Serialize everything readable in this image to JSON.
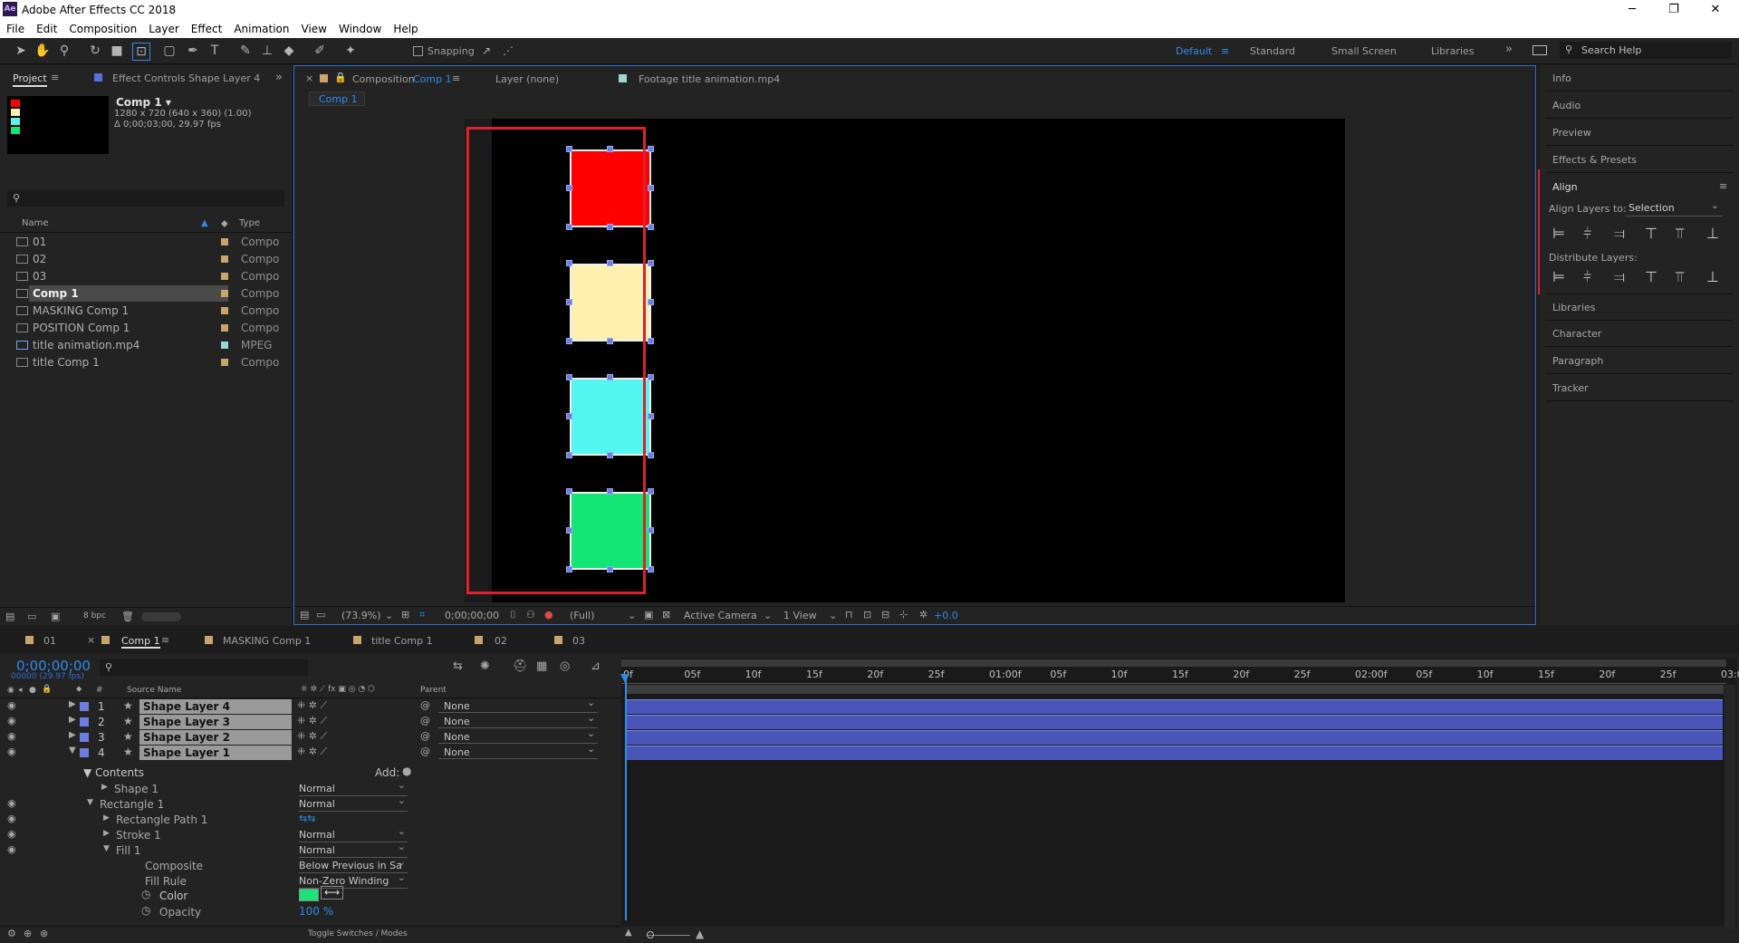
{
  "app": {
    "title": "Adobe After Effects CC 2018",
    "icon_label": "Ae"
  },
  "window_controls": {
    "minimize": "─",
    "restore": "❐",
    "close": "✕"
  },
  "menu": [
    "File",
    "Edit",
    "Composition",
    "Layer",
    "Effect",
    "Animation",
    "View",
    "Window",
    "Help"
  ],
  "toolbar": {
    "snapping_label": "Snapping",
    "workspaces": [
      "Default",
      "Standard",
      "Small Screen",
      "Libraries"
    ],
    "search_placeholder": "Search Help"
  },
  "project_panel": {
    "tab_project": "Project",
    "tab_effect_controls": "Effect Controls Shape Layer 4",
    "comp_name": "Comp 1 ▾",
    "comp_info_1": "1280 x 720  (640 x 360) (1.00)",
    "comp_info_2": "Δ 0;00;03;00, 29.97 fps",
    "col_name": "Name",
    "col_type": "Type",
    "items": [
      {
        "name": "01",
        "type": "Compo"
      },
      {
        "name": "02",
        "type": "Compo"
      },
      {
        "name": "03",
        "type": "Compo"
      },
      {
        "name": "Comp 1",
        "type": "Compo"
      },
      {
        "name": "MASKING Comp 1",
        "type": "Compo"
      },
      {
        "name": "POSITION Comp 1",
        "type": "Compo"
      },
      {
        "name": "title animation.mp4",
        "type": "MPEG"
      },
      {
        "name": "title Comp 1",
        "type": "Compo"
      }
    ],
    "bpc": "8 bpc"
  },
  "viewer": {
    "tab_composition": "Composition",
    "tab_comp_name": "Comp 1",
    "tab_layer": "Layer (none)",
    "tab_footage": "Footage title animation.mp4",
    "breadcrumb": "Comp 1",
    "zoom": "(73.9%)",
    "timecode": "0;00;00;00",
    "resolution": "(Full)",
    "camera": "Active Camera",
    "views": "1 View",
    "exposure": "+0.0",
    "squares": [
      {
        "color": "#ff0000"
      },
      {
        "color": "#fff0b0"
      },
      {
        "color": "#55f5f2"
      },
      {
        "color": "#14e676"
      }
    ]
  },
  "right_panel": {
    "top_items": [
      "Info",
      "Audio",
      "Preview",
      "Effects & Presets"
    ],
    "align_title": "Align",
    "align_layers_to_label": "Align Layers to:",
    "align_layers_to_value": "Selection",
    "distribute_label": "Distribute Layers:",
    "bottom_items": [
      "Libraries",
      "Character",
      "Paragraph",
      "Tracker"
    ]
  },
  "timeline_tabs": [
    "01",
    "Comp 1",
    "MASKING Comp 1",
    "title Comp 1",
    "02",
    "03"
  ],
  "timeline": {
    "timecode": "0;00;00;00",
    "fps_info": "00000 (29.97 fps)",
    "col_source_name": "Source Name",
    "col_parent": "Parent",
    "col_hash": "#",
    "layers": [
      {
        "num": "1",
        "name": "Shape Layer 4",
        "parent": "None"
      },
      {
        "num": "2",
        "name": "Shape Layer 3",
        "parent": "None"
      },
      {
        "num": "3",
        "name": "Shape Layer 2",
        "parent": "None"
      },
      {
        "num": "4",
        "name": "Shape Layer 1",
        "parent": "None"
      }
    ],
    "contents_label": "Contents",
    "add_label": "Add:",
    "props": [
      {
        "name": "Shape 1",
        "value": "Normal"
      },
      {
        "name": "Rectangle 1",
        "value": "Normal"
      },
      {
        "name": "Rectangle Path 1",
        "value": ""
      },
      {
        "name": "Stroke 1",
        "value": "Normal"
      },
      {
        "name": "Fill 1",
        "value": "Normal"
      },
      {
        "name": "Composite",
        "value": "Below Previous in Sa"
      },
      {
        "name": "Fill Rule",
        "value": "Non-Zero Winding"
      }
    ],
    "color_label": "Color",
    "color_value": "#1ee27a",
    "opacity_label": "Opacity",
    "opacity_value": "100 %",
    "toggle_label": "Toggle Switches / Modes",
    "ruler": [
      "0f",
      "05f",
      "10f",
      "15f",
      "20f",
      "25f",
      "01:00f",
      "05f",
      "10f",
      "15f",
      "20f",
      "25f",
      "02:00f",
      "05f",
      "10f",
      "15f",
      "20f",
      "25f",
      "03:0"
    ]
  }
}
